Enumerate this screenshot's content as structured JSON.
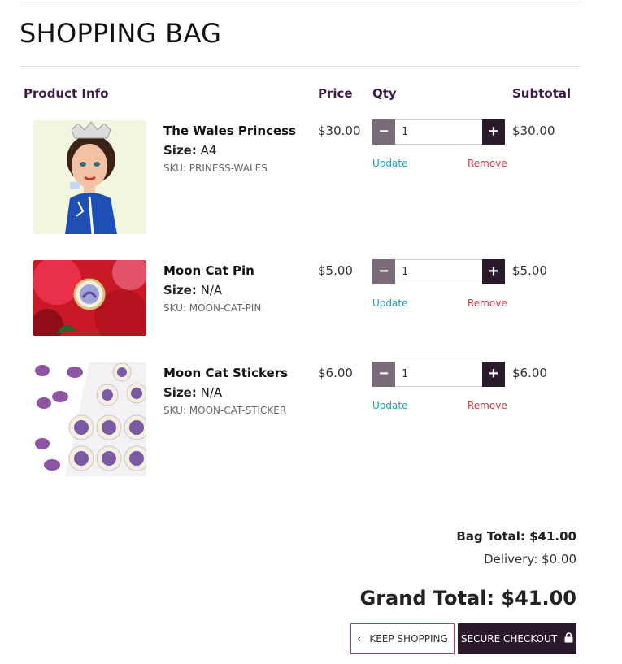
{
  "page": {
    "title": "SHOPPING BAG"
  },
  "table": {
    "headers": {
      "product": "Product Info",
      "price": "Price",
      "qty": "Qty",
      "subtotal": "Subtotal"
    },
    "items": [
      {
        "name": "The Wales Princess",
        "size_label": "Size:",
        "size": "A4",
        "sku": "SKU: PRINESS-WALES",
        "price": "$30.00",
        "qty": "1",
        "subtotal": "$30.00",
        "update": "Update",
        "remove": "Remove"
      },
      {
        "name": "Moon Cat Pin",
        "size_label": "Size:",
        "size": "N/A",
        "sku": "SKU: MOON-CAT-PIN",
        "price": "$5.00",
        "qty": "1",
        "subtotal": "$5.00",
        "update": "Update",
        "remove": "Remove"
      },
      {
        "name": "Moon Cat Stickers",
        "size_label": "Size:",
        "size": "N/A",
        "sku": "SKU: MOON-CAT-STICKER",
        "price": "$6.00",
        "qty": "1",
        "subtotal": "$6.00",
        "update": "Update",
        "remove": "Remove"
      }
    ]
  },
  "totals": {
    "bag_total": "Bag Total: $41.00",
    "delivery": "Delivery: $0.00",
    "grand_total": "Grand Total: $41.00"
  },
  "actions": {
    "keep_shopping": "KEEP SHOPPING",
    "secure_checkout": "SECURE CHECKOUT"
  },
  "icons": {
    "minus": "minus-icon",
    "plus": "plus-icon",
    "chevron": "chevron-left-icon",
    "lock": "lock-icon"
  },
  "colors": {
    "header_text": "#3d1a4a",
    "dark_button": "#2b1a2b",
    "minus_button": "#7a6b78",
    "update_link": "#17a2b8",
    "remove_link": "#dc3545",
    "keep_border": "#b03c6a"
  }
}
